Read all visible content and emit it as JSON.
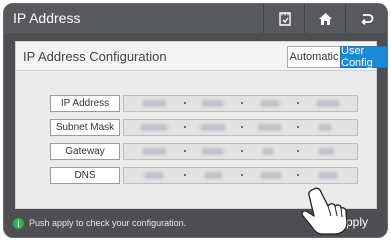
{
  "titlebar": {
    "title": "IP Address",
    "buttons": [
      {
        "icon": "note-icon"
      },
      {
        "icon": "home-icon"
      },
      {
        "icon": "back-icon"
      }
    ]
  },
  "panel": {
    "title": "IP Address Configuration",
    "mode": {
      "automatic_label": "Automatic",
      "user_config_label": "User Config",
      "selected": "User Config",
      "accent": "#1a8ad8"
    },
    "rows": [
      {
        "label": "IP Address"
      },
      {
        "label": "Subnet Mask"
      },
      {
        "label": "Gateway"
      },
      {
        "label": "DNS"
      }
    ]
  },
  "footer": {
    "hint": "Push apply to check your configuration.",
    "apply_label": "Apply",
    "hint_icon": "info-icon"
  }
}
